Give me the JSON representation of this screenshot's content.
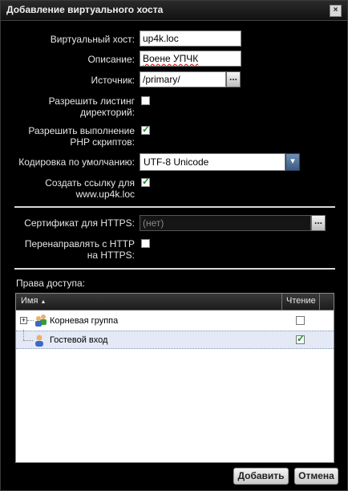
{
  "window": {
    "title": "Добавление виртуального хоста",
    "close_glyph": "×"
  },
  "form": {
    "virtual_host": {
      "label": "Виртуальный хост:",
      "value": "up4k.loc"
    },
    "description": {
      "label": "Описание:",
      "value": "Воене УПЧК"
    },
    "source": {
      "label": "Источник:",
      "value": "/primary/",
      "browse": "..."
    },
    "dir_listing": {
      "label_line1": "Разрешить листинг",
      "label_line2": "директорий:",
      "checked": false
    },
    "php": {
      "label_line1": "Разрешить выполнение",
      "label_line2": "PHP скриптов:",
      "checked": true
    },
    "encoding": {
      "label": "Кодировка по умолчанию:",
      "value": "UTF-8 Unicode"
    },
    "create_link": {
      "label_line1": "Создать ссылку для",
      "label_line2": "www.up4k.loc",
      "checked": true
    },
    "https_cert": {
      "label": "Сертификат для HTTPS:",
      "value": "(нет)",
      "browse": "..."
    },
    "redirect": {
      "label_line1": "Перенаправлять с HTTP",
      "label_line2": "на HTTPS:",
      "checked": false
    }
  },
  "access": {
    "label": "Права доступа:",
    "columns": {
      "name": "Имя",
      "sort_glyph": "▲",
      "read": "Чтение"
    },
    "rows": [
      {
        "name": "Корневая группа",
        "read": false,
        "expander": "+"
      },
      {
        "name": "Гостевой вход",
        "read": true
      }
    ]
  },
  "buttons": {
    "add": "Добавить",
    "cancel": "Отмена"
  }
}
